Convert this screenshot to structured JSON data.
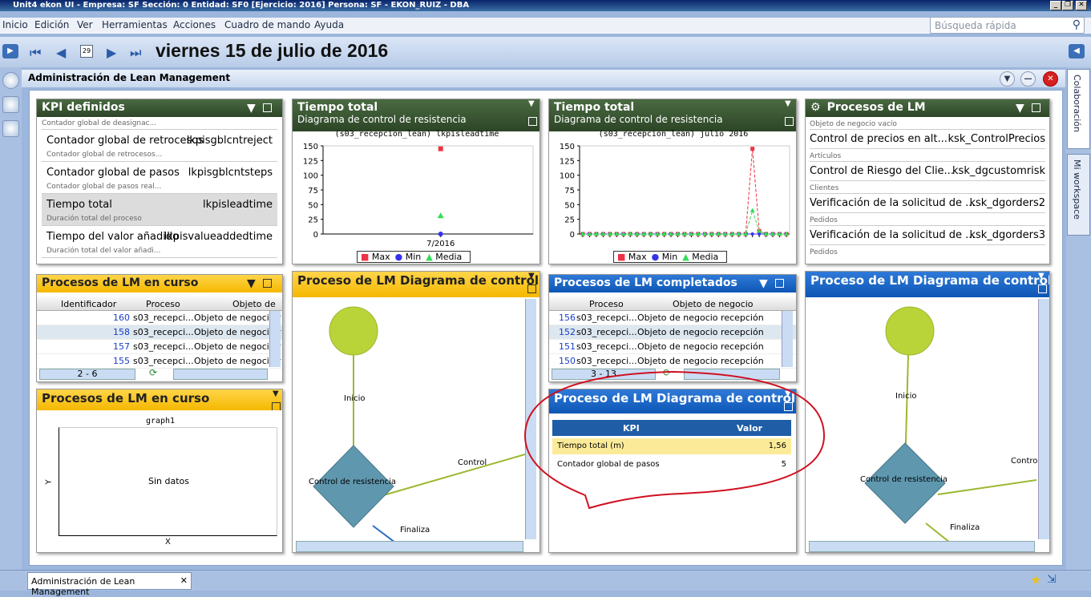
{
  "window": {
    "title": "Unit4 ekon UI - Empresa: SF Sección: 0 Entidad: SF0 [Ejercicio: 2016] Persona: SF - EKON_RUIZ - DBA"
  },
  "menu": [
    "Inicio",
    "Edición",
    "Ver",
    "Herramientas",
    "Acciones",
    "Cuadro de mando",
    "Ayuda"
  ],
  "search": {
    "placeholder": "Búsqueda rápida"
  },
  "date": {
    "text": "viernes 15 de julio de 2016",
    "calendar_day": "29"
  },
  "side_tabs": [
    "Colaboración",
    "Mi workspace"
  ],
  "main": {
    "title": "Administración de Lean Management"
  },
  "kpi_panel": {
    "title": "KPI definidos",
    "top_desc": "Contador global de deasignac...",
    "rows": [
      {
        "name": "Contador global de retrocesos",
        "code": "lkpisgblcntreject",
        "desc": "Contador global de retrocesos..."
      },
      {
        "name": "Contador global de pasos",
        "code": "lkpisgblcntsteps",
        "desc": "Contador global de pasos real..."
      },
      {
        "name": "Tiempo total",
        "code": "lkpisleadtime",
        "desc": "Duración total del proceso"
      },
      {
        "name": "Tiempo del valor añadido",
        "code": "lkpisvalueaddedtime",
        "desc": "Duración total del valor añadi..."
      }
    ]
  },
  "chart1": {
    "title": "Tiempo total",
    "subtitle": "Diagrama de control de resistencia",
    "caption": "(s03_recepcion_lean) lkpisleadtime"
  },
  "chart2": {
    "title": "Tiempo total",
    "subtitle": "Diagrama de control de resistencia",
    "caption": "(s03_recepcion_lean) julio 2016"
  },
  "chart_data": [
    {
      "type": "scatter",
      "title": "(s03_recepcion_lean) lkpisleadtime",
      "categories": [
        "7/2016"
      ],
      "series": [
        {
          "name": "Max",
          "color": "#ee3344",
          "values": [
            145
          ]
        },
        {
          "name": "Min",
          "color": "#3333ee",
          "values": [
            0
          ]
        },
        {
          "name": "Media",
          "color": "#33dd55",
          "values": [
            31
          ]
        }
      ],
      "yticks": [
        "150",
        "125",
        "100",
        "75",
        "50",
        "25",
        "0"
      ],
      "ylim": [
        0,
        150
      ]
    },
    {
      "type": "line",
      "title": "(s03_recepcion_lean) julio 2016",
      "x_count": 31,
      "series": [
        {
          "name": "Max",
          "color": "#ee3344",
          "values": [
            0,
            0,
            0,
            0,
            0,
            0,
            0,
            0,
            0,
            0,
            0,
            0,
            0,
            0,
            0,
            0,
            0,
            0,
            0,
            0,
            0,
            0,
            0,
            0,
            0,
            145,
            5,
            0,
            0,
            0,
            0
          ]
        },
        {
          "name": "Min",
          "color": "#3333ee",
          "values": [
            0,
            0,
            0,
            0,
            0,
            0,
            0,
            0,
            0,
            0,
            0,
            0,
            0,
            0,
            0,
            0,
            0,
            0,
            0,
            0,
            0,
            0,
            0,
            0,
            0,
            0,
            0,
            0,
            0,
            0,
            0
          ]
        },
        {
          "name": "Media",
          "color": "#33dd55",
          "values": [
            0,
            0,
            0,
            0,
            0,
            0,
            0,
            0,
            0,
            0,
            0,
            0,
            0,
            0,
            0,
            0,
            0,
            0,
            0,
            0,
            0,
            0,
            0,
            0,
            0,
            40,
            5,
            0,
            0,
            0,
            0
          ]
        }
      ],
      "yticks": [
        "150",
        "125",
        "100",
        "75",
        "50",
        "25",
        "0"
      ],
      "ylim": [
        0,
        150
      ]
    },
    {
      "type": "scatter",
      "title": "graph1",
      "xlabel": "X",
      "ylabel": "Y",
      "empty_text": "Sin datos",
      "series": []
    }
  ],
  "legend": [
    "Max",
    "Min",
    "Media"
  ],
  "procesos_panel": {
    "title": "Procesos de LM",
    "groups": [
      {
        "header": "Objeto de negocio vacío",
        "name": "Control de precios en alt...",
        "code": "ksk_ControlPrecios"
      },
      {
        "header": "Artículos",
        "name": "Control de Riesgo del Clie...",
        "code": "ksk_dgcustomrisk"
      },
      {
        "header": "Clientes",
        "name": "Verificación de la solicitud de ...",
        "code": "ksk_dgorders2"
      },
      {
        "header": "Pedidos",
        "name": "Verificación de la solicitud de ...",
        "code": "ksk_dgorders3"
      }
    ],
    "footer": "Pedidos"
  },
  "encurso": {
    "title": "Procesos de LM en curso",
    "cols": [
      "Identificador",
      "Proceso",
      "Objeto de"
    ],
    "rows": [
      {
        "id": "160",
        "proc": "s03_recepci...",
        "obj": "Objeto de negocio r"
      },
      {
        "id": "158",
        "proc": "s03_recepci...",
        "obj": "Objeto de negocio r"
      },
      {
        "id": "157",
        "proc": "s03_recepci...",
        "obj": "Objeto de negocio r"
      },
      {
        "id": "155",
        "proc": "s03_recepci...",
        "obj": "Objeto de negocio r"
      }
    ],
    "pager": "2 - 6"
  },
  "encurso2": {
    "title": "Procesos de LM en curso"
  },
  "diagram1": {
    "title": "Proceso de LM Diagrama de control d",
    "inicio": "Inicio",
    "control_node": "Control de resistencia",
    "edge_control": "Control",
    "finaliza": "Finaliza"
  },
  "completados": {
    "title": "Procesos de LM completados",
    "cols": [
      "Proceso",
      "Objeto de negocio"
    ],
    "rows": [
      {
        "id": "156",
        "proc": "s03_recepci...",
        "obj": "Objeto de negocio recepción"
      },
      {
        "id": "152",
        "proc": "s03_recepci...",
        "obj": "Objeto de negocio recepción"
      },
      {
        "id": "151",
        "proc": "s03_recepci...",
        "obj": "Objeto de negocio recepción"
      },
      {
        "id": "150",
        "proc": "s03_recepci...",
        "obj": "Objeto de negocio recepción"
      }
    ],
    "pager": "3 - 13"
  },
  "kpi_table": {
    "title": "Proceso de LM Diagrama de control d",
    "cols": [
      "KPI",
      "Valor"
    ],
    "rows": [
      {
        "kpi": "Tiempo total (m)",
        "val": "1,56"
      },
      {
        "kpi": "Contador global de pasos",
        "val": "5"
      }
    ]
  },
  "diagram2": {
    "title": "Proceso de LM Diagrama de control d",
    "inicio": "Inicio",
    "control_node": "Control de resistencia",
    "edge_control": "Contro",
    "finaliza": "Finaliza"
  },
  "bottom_tab": "Administración de Lean Management",
  "colors": {
    "green": "#3a5834",
    "yellow": "#f5c000",
    "blue": "#1565c8",
    "annotation": "#d01020"
  }
}
